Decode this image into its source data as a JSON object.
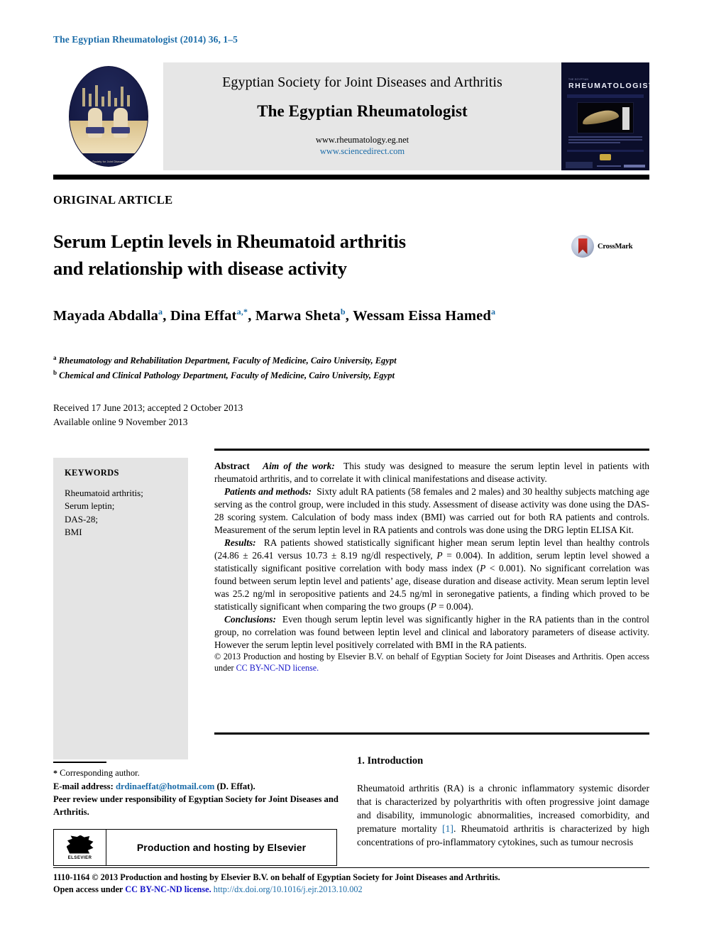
{
  "running_head": "The Egyptian Rheumatologist (2014) 36, 1–5",
  "masthead": {
    "society_logo_caption": "The Egyptian Society for Joint Diseases and Arthritis",
    "society_name": "Egyptian Society for Joint Diseases and Arthritis",
    "journal_name": "The Egyptian Rheumatologist",
    "url_primary": "www.rheumatology.eg.net",
    "url_secondary": "www.sciencedirect.com",
    "cover_eyebrow": "THE EGYPTIAN",
    "cover_title": "RHEUMATOLOGIST"
  },
  "article": {
    "type": "ORIGINAL ARTICLE",
    "title_line_1": "Serum Leptin levels in Rheumatoid arthritis",
    "title_line_2": "and relationship with disease activity",
    "crossmark_label": "CrossMark",
    "authors": "Mayada Abdalla , Dina Effat , Marwa Sheta , Wessam Eissa Hamed",
    "authors_parts": [
      {
        "name": "Mayada Abdalla",
        "sup": "a",
        "sep": ", "
      },
      {
        "name": "Dina Effat",
        "sup": "a,*",
        "sep": ", "
      },
      {
        "name": "Marwa Sheta",
        "sup": "b",
        "sep": ", "
      },
      {
        "name": "Wessam Eissa Hamed",
        "sup": "a",
        "sep": ""
      }
    ],
    "affiliation_a": "Rheumatology and Rehabilitation Department, Faculty of Medicine, Cairo University, Egypt",
    "affiliation_b": "Chemical and Clinical Pathology Department, Faculty of Medicine, Cairo University, Egypt",
    "affiliation_a_marker": "a",
    "affiliation_b_marker": "b",
    "history_line_1": "Received 17 June 2013; accepted 2 October 2013",
    "history_line_2": "Available online 9 November 2013"
  },
  "keywords": {
    "heading": "KEYWORDS",
    "items": [
      "Rheumatoid arthritis;",
      "Serum leptin;",
      "DAS-28;",
      "BMI"
    ]
  },
  "abstract": {
    "label": "Abstract",
    "aim_label": "Aim of the work:",
    "aim_text": "This study was designed to measure the serum leptin level in patients with rheumatoid arthritis, and to correlate it with clinical manifestations and disease activity.",
    "methods_label": "Patients and methods:",
    "methods_text": "Sixty adult RA patients (58 females and 2 males) and 30 healthy subjects matching age serving as the control group, were included in this study. Assessment of disease activity was done using the DAS-28 scoring system. Calculation of body mass index (BMI) was carried out for both RA patients and controls. Measurement of the serum leptin level in RA patients and controls was done using the DRG leptin ELISA Kit.",
    "results_label": "Results:",
    "results_text_1": "RA patients showed statistically significant higher mean serum leptin level than healthy controls (24.86 ± 26.41 versus 10.73 ± 8.19 ng/dl respectively, ",
    "results_p1": "P",
    "results_text_2": " = 0.004). In addition, serum leptin level showed a statistically significant positive correlation with body mass index (",
    "results_p2": "P",
    "results_text_3": " < 0.001). No significant correlation was found between serum leptin level and patients’ age, disease duration and disease activity. Mean serum leptin level was 25.2 ng/ml in seropositive patients and 24.5 ng/ml in seronegative patients, a finding which proved to be statistically significant when comparing the two groups (",
    "results_p3": "P",
    "results_text_4": " = 0.004).",
    "conclusions_label": "Conclusions:",
    "conclusions_text": "Even though serum leptin level was significantly higher in the RA patients than in the control group, no correlation was found between leptin level and clinical and laboratory parameters of disease activity. However the serum leptin level positively correlated with BMI in the RA patients.",
    "copyright_text": "© 2013 Production and hosting by Elsevier B.V. on behalf of Egyptian Society for Joint Diseases and Arthritis. Open access under ",
    "copyright_license": "CC BY-NC-ND license."
  },
  "footnotes": {
    "star": "*",
    "corresponding": "Corresponding author.",
    "email_label": "E-mail address:",
    "email": "drdinaeffat@hotmail.com",
    "email_suffix": "(D. Effat).",
    "peer_review": "Peer review under responsibility of Egyptian Society for Joint Diseases and Arthritis."
  },
  "elsevier_banner": {
    "logo_word": "ELSEVIER",
    "text": "Production and hosting by Elsevier"
  },
  "introduction": {
    "heading": "1. Introduction",
    "paragraph_1": "Rheumatoid arthritis (RA) is a chronic inflammatory systemic disorder that is characterized by polyarthritis with often progressive joint damage and disability, immunologic abnormalities, increased comorbidity, and premature mortality ",
    "reference_1": "[1]",
    "paragraph_2": ". Rheumatoid arthritis is characterized by high concentrations of pro-inflammatory cytokines, such as tumour necrosis"
  },
  "bottom": {
    "line_1": "1110-1164 © 2013 Production and hosting by Elsevier B.V. on behalf of Egyptian Society for Joint Diseases and Arthritis.",
    "line_2_prefix": "Open access under ",
    "line_2_license": "CC BY-NC-ND license.",
    "line_2_doi": "http://dx.doi.org/10.1016/j.ejr.2013.10.002"
  },
  "colors": {
    "link_blue": "#1b6ca8",
    "license_blue": "#1414c8",
    "panel_gray": "#e4e4e4",
    "masthead_gray": "#e6e6e6",
    "cover_navy": "#0b0e2b"
  }
}
